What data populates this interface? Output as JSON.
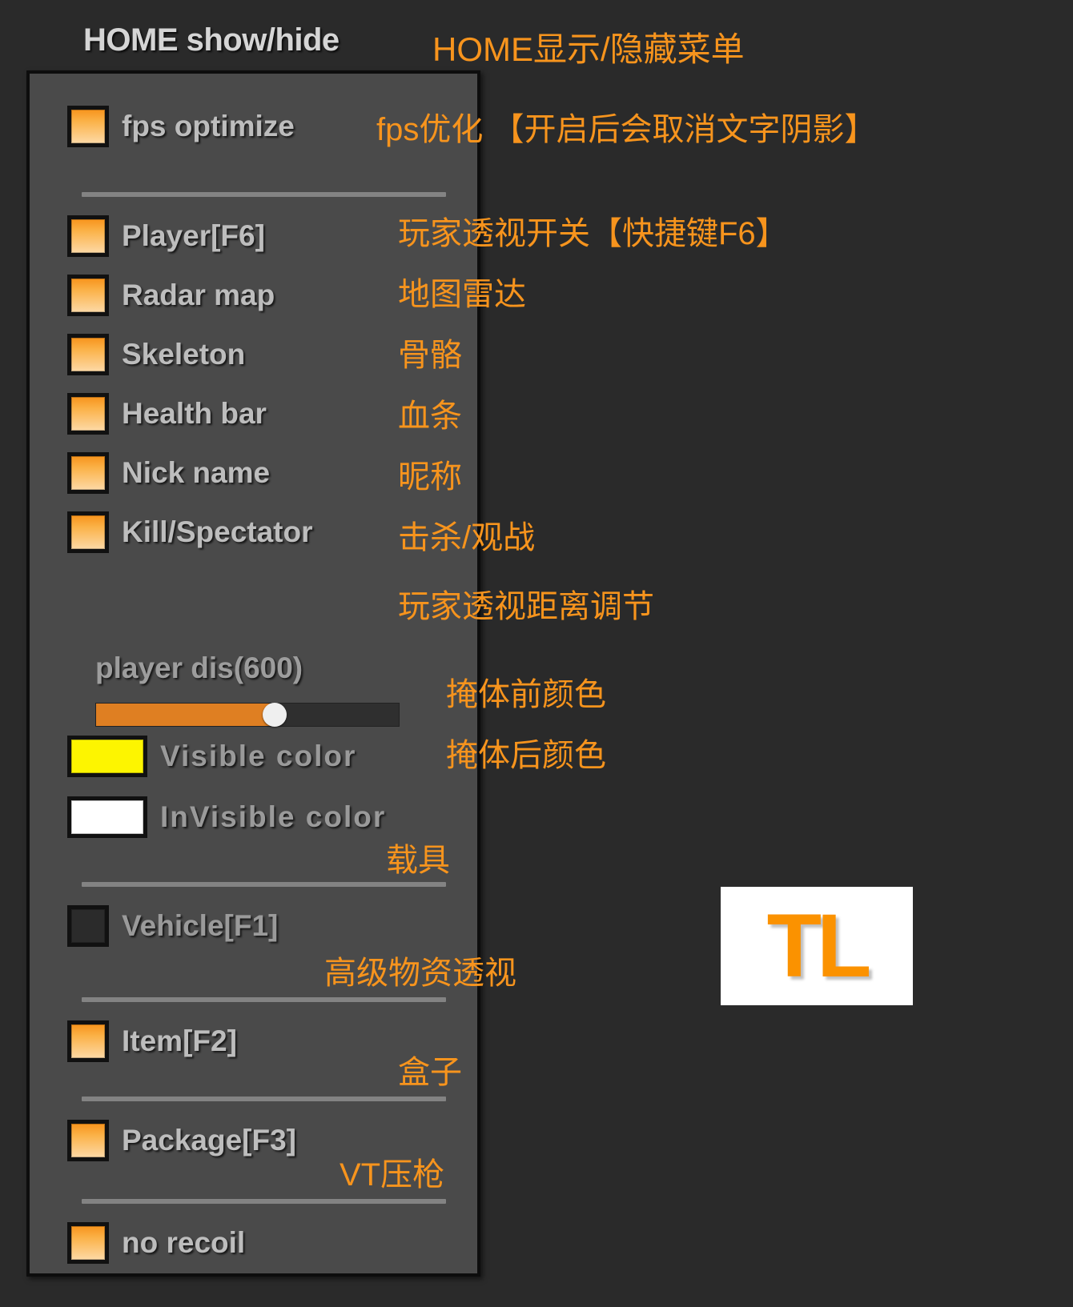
{
  "header": {
    "title": "HOME show/hide",
    "title_cn": "HOME显示/隐藏菜单"
  },
  "colors": {
    "accent": "#f7941d",
    "panel_bg": "#4a4a4a",
    "page_bg": "#2a2a2a",
    "label": "#bdbdbd",
    "visible_color": "#fdf500",
    "invisible_color": "#ffffff",
    "slider_fill": "#df7f22",
    "logo_orange": "#fb9200"
  },
  "rows": [
    {
      "label": "fps optimize",
      "cn": "fps优化 【开启后会取消文字阴影】",
      "checked": true,
      "type": "checkbox"
    },
    {
      "label": "Player[F6]",
      "cn": "玩家透视开关【快捷键F6】",
      "checked": true,
      "type": "checkbox"
    },
    {
      "label": "Radar map",
      "cn": "地图雷达",
      "checked": true,
      "type": "checkbox"
    },
    {
      "label": "Skeleton",
      "cn": "骨骼",
      "checked": true,
      "type": "checkbox"
    },
    {
      "label": "Health bar",
      "cn": "血条",
      "checked": true,
      "type": "checkbox"
    },
    {
      "label": "Nick name",
      "cn": "昵称",
      "checked": true,
      "type": "checkbox"
    },
    {
      "label": "Kill/Spectator",
      "cn": "击杀/观战",
      "checked": true,
      "type": "checkbox"
    },
    {
      "label": "Visible color",
      "cn": "掩体前颜色",
      "checked": true,
      "type": "color"
    },
    {
      "label": "InVisible color",
      "cn": "掩体后颜色",
      "checked": true,
      "type": "color"
    },
    {
      "label": "Vehicle[F1]",
      "cn": "载具",
      "checked": false,
      "type": "checkbox"
    },
    {
      "label": "Item[F2]",
      "cn": "高级物资透视",
      "checked": true,
      "type": "checkbox"
    },
    {
      "label": "Package[F3]",
      "cn": "盒子",
      "checked": true,
      "type": "checkbox"
    },
    {
      "label": "no recoil",
      "cn": "VT压枪",
      "checked": true,
      "type": "checkbox"
    }
  ],
  "slider": {
    "label": "player dis(600)",
    "cn": "玩家透视距离调节",
    "value": 600,
    "percent": 59
  },
  "logo": {
    "text": "TL"
  }
}
